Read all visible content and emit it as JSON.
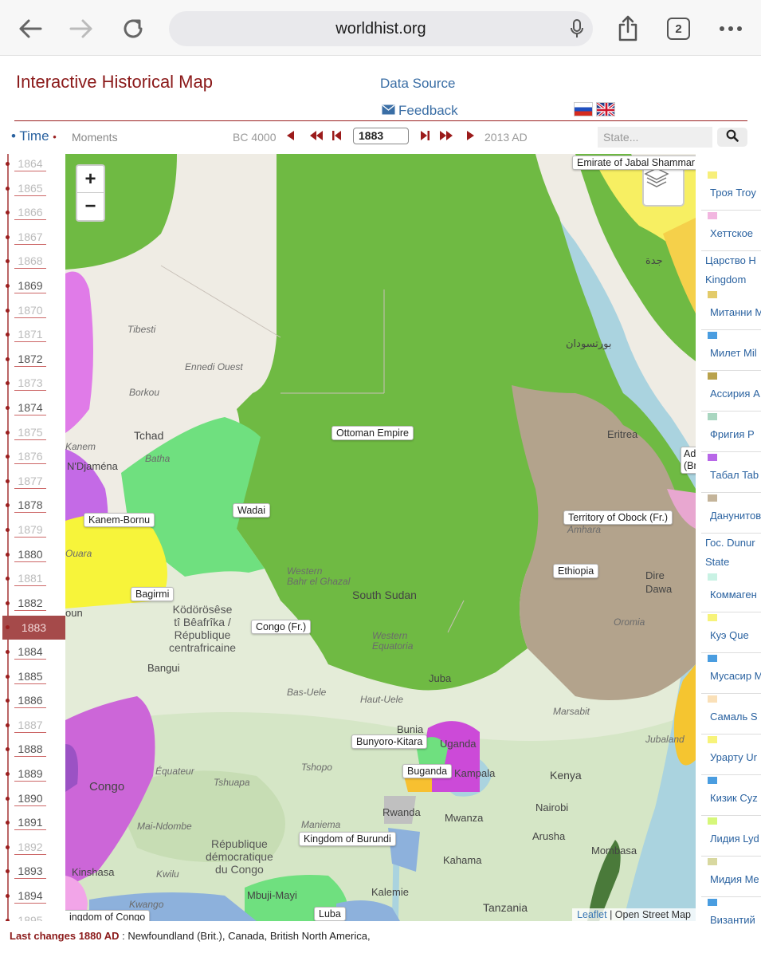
{
  "browser": {
    "url": "worldhist.org",
    "tabs_count": "2"
  },
  "header": {
    "title": "Interactive Historical Map",
    "data_source": "Data Source",
    "feedback": "Feedback"
  },
  "timebar": {
    "time": "Time",
    "moments": "Moments",
    "start": "BC 4000",
    "current_year": "1883",
    "end": "2013 AD",
    "state_placeholder": "State..."
  },
  "years": [
    "1864",
    "1865",
    "1866",
    "1867",
    "1868",
    "1869",
    "1870",
    "1871",
    "1872",
    "1873",
    "1874",
    "1875",
    "1876",
    "1877",
    "1878",
    "1879",
    "1880",
    "1881",
    "1882",
    "1883",
    "1884",
    "1885",
    "1886",
    "1887",
    "1888",
    "1889",
    "1890",
    "1891",
    "1892",
    "1893",
    "1894",
    "1895"
  ],
  "map": {
    "states": {
      "emirate_jabal_shammar": "Emirate of Jabal Shammar",
      "ottoman": "Ottoman Empire",
      "wadai": "Wadai",
      "kanem_bornu": "Kanem-Bornu",
      "bagirmi": "Bagirmi",
      "congo_fr": "Congo (Fr.)",
      "obock": "Territory of Obock (Fr.)",
      "ethiopia": "Ethiopia",
      "bunyoro": "Bunyoro-Kitara",
      "buganda": "Buganda",
      "burundi": "Kingdom of Burundi",
      "luba": "Luba",
      "kongo": "ingdom of Congo",
      "aden": "Ad",
      "aden2": "(Br"
    },
    "places": {
      "tibesti": "Tibesti",
      "ennedi": "Ennedi Ouest",
      "borkou": "Borkou",
      "tchad": "Tchad",
      "kanem": "Kanem",
      "djamena": "N'Djaména",
      "batha": "Batha",
      "car": "Ködörösêse\ntî Bêafrîka /\nRépublique\ncentrafricaine",
      "bangui": "Bangui",
      "bas_uele": "Bas-Uele",
      "haut_uele": "Haut-Uele",
      "equateur": "Équateur",
      "tshopo": "Tshopo",
      "tshuapa": "Tshuapa",
      "congo": "Congo",
      "mai_ndombe": "Mai-Ndombe",
      "maniema": "Maniema",
      "drc": "République\ndémocratique\ndu Congo",
      "kinshasa": "Kinshasa",
      "kwilu": "Kwilu",
      "kwango": "Kwango",
      "kalemie": "Kalemie",
      "tanzania": "Tanzania",
      "kahama": "Kahama",
      "mwanza": "Mwanza",
      "arusha": "Arusha",
      "mombasa": "Mombasa",
      "nairobi": "Nairobi",
      "kenya": "Kenya",
      "marsabit": "Marsabit",
      "jubaland": "Jubaland",
      "rwanda": "Rwanda",
      "bunia": "Bunia",
      "uganda": "Uganda",
      "kampala": "Kampala",
      "mbuji": "Mbuji-Mayi",
      "south_sudan": "South Sudan",
      "western_bahr": "Western\nBahr el Ghazal",
      "western_eq": "Western\nEquatoria",
      "juba": "Juba",
      "eritrea": "Eritrea",
      "dire_dawa": "Dire\nDawa",
      "amhara": "Amhara",
      "oromia": "Oromia",
      "port_sudan": "بورتسودان",
      "jeddah": "جدة",
      "ouara": "Ouara",
      "oun": "oun"
    },
    "attribution_leaflet": "Leaflet",
    "attribution_sep": " | ",
    "attribution_osm": "Open Street Map"
  },
  "legend": [
    {
      "label": "Троя Troy",
      "color": "#f7ef7a"
    },
    {
      "label": "Хеттское",
      "color": "#f2b6e0"
    },
    {
      "label": "Царство H",
      "color": ""
    },
    {
      "label": "Kingdom",
      "color": ""
    },
    {
      "label": "Митанни M",
      "color": "#e3cb6a"
    },
    {
      "label": "Милет Mil",
      "color": "#4a9de0"
    },
    {
      "label": "Ассирия A",
      "color": "#b9a24c"
    },
    {
      "label": "Фригия P",
      "color": "#a9d6c0"
    },
    {
      "label": "Табал Tab",
      "color": "#b867e8"
    },
    {
      "label": "Данунитов",
      "color": "#c4b49a"
    },
    {
      "label": "Гос. Dunur",
      "color": ""
    },
    {
      "label": "State",
      "color": ""
    },
    {
      "label": "Коммаген",
      "color": "#c9f2e4"
    },
    {
      "label": "Куэ Que",
      "color": "#f7f37a"
    },
    {
      "label": "Мусасир M",
      "color": "#4a9de0"
    },
    {
      "label": "Самаль S",
      "color": "#fae0b8"
    },
    {
      "label": "Урарту Ur",
      "color": "#f7f37a"
    },
    {
      "label": "Кизик Cyz",
      "color": "#4a9de0"
    },
    {
      "label": "Лидия Lyd",
      "color": "#d6f77a"
    },
    {
      "label": "Мидия Me",
      "color": "#d8d8a0"
    },
    {
      "label": "Византий",
      "color": "#4a9de0"
    }
  ],
  "footer": {
    "last_changes": "Last changes 1880 AD",
    "colon": " : ",
    "text": "Newfoundland (Brit.), Canada, British North America,"
  }
}
